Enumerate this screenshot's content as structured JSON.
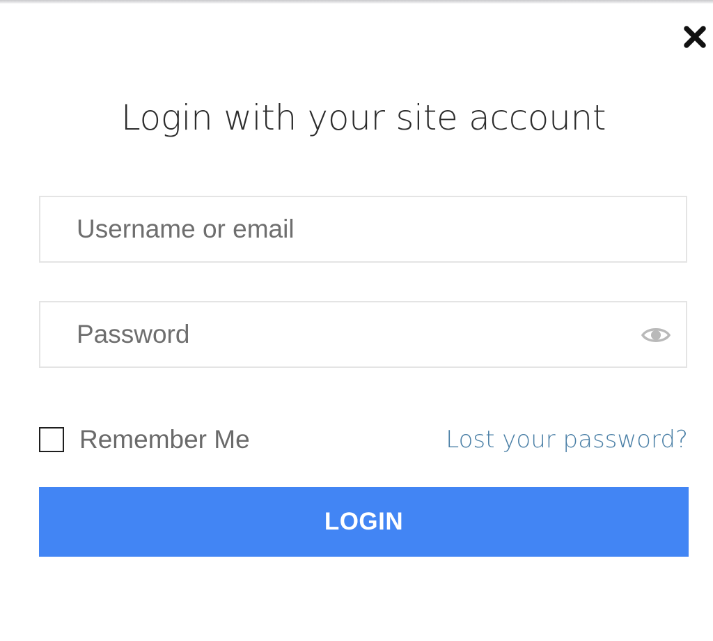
{
  "dialog": {
    "title": "Login with your site account",
    "close_icon": "close-icon"
  },
  "form": {
    "username": {
      "placeholder": "Username or email",
      "value": ""
    },
    "password": {
      "placeholder": "Password",
      "value": "",
      "toggle_icon": "eye-icon"
    },
    "remember_me": {
      "label": "Remember Me",
      "checked": false
    },
    "lost_password_label": "Lost your password?",
    "login_label": "LOGIN"
  },
  "colors": {
    "accent": "#4285f4",
    "link": "#4a7fa6",
    "title_text": "#2c2c2c",
    "field_border": "#e4e4e4"
  }
}
